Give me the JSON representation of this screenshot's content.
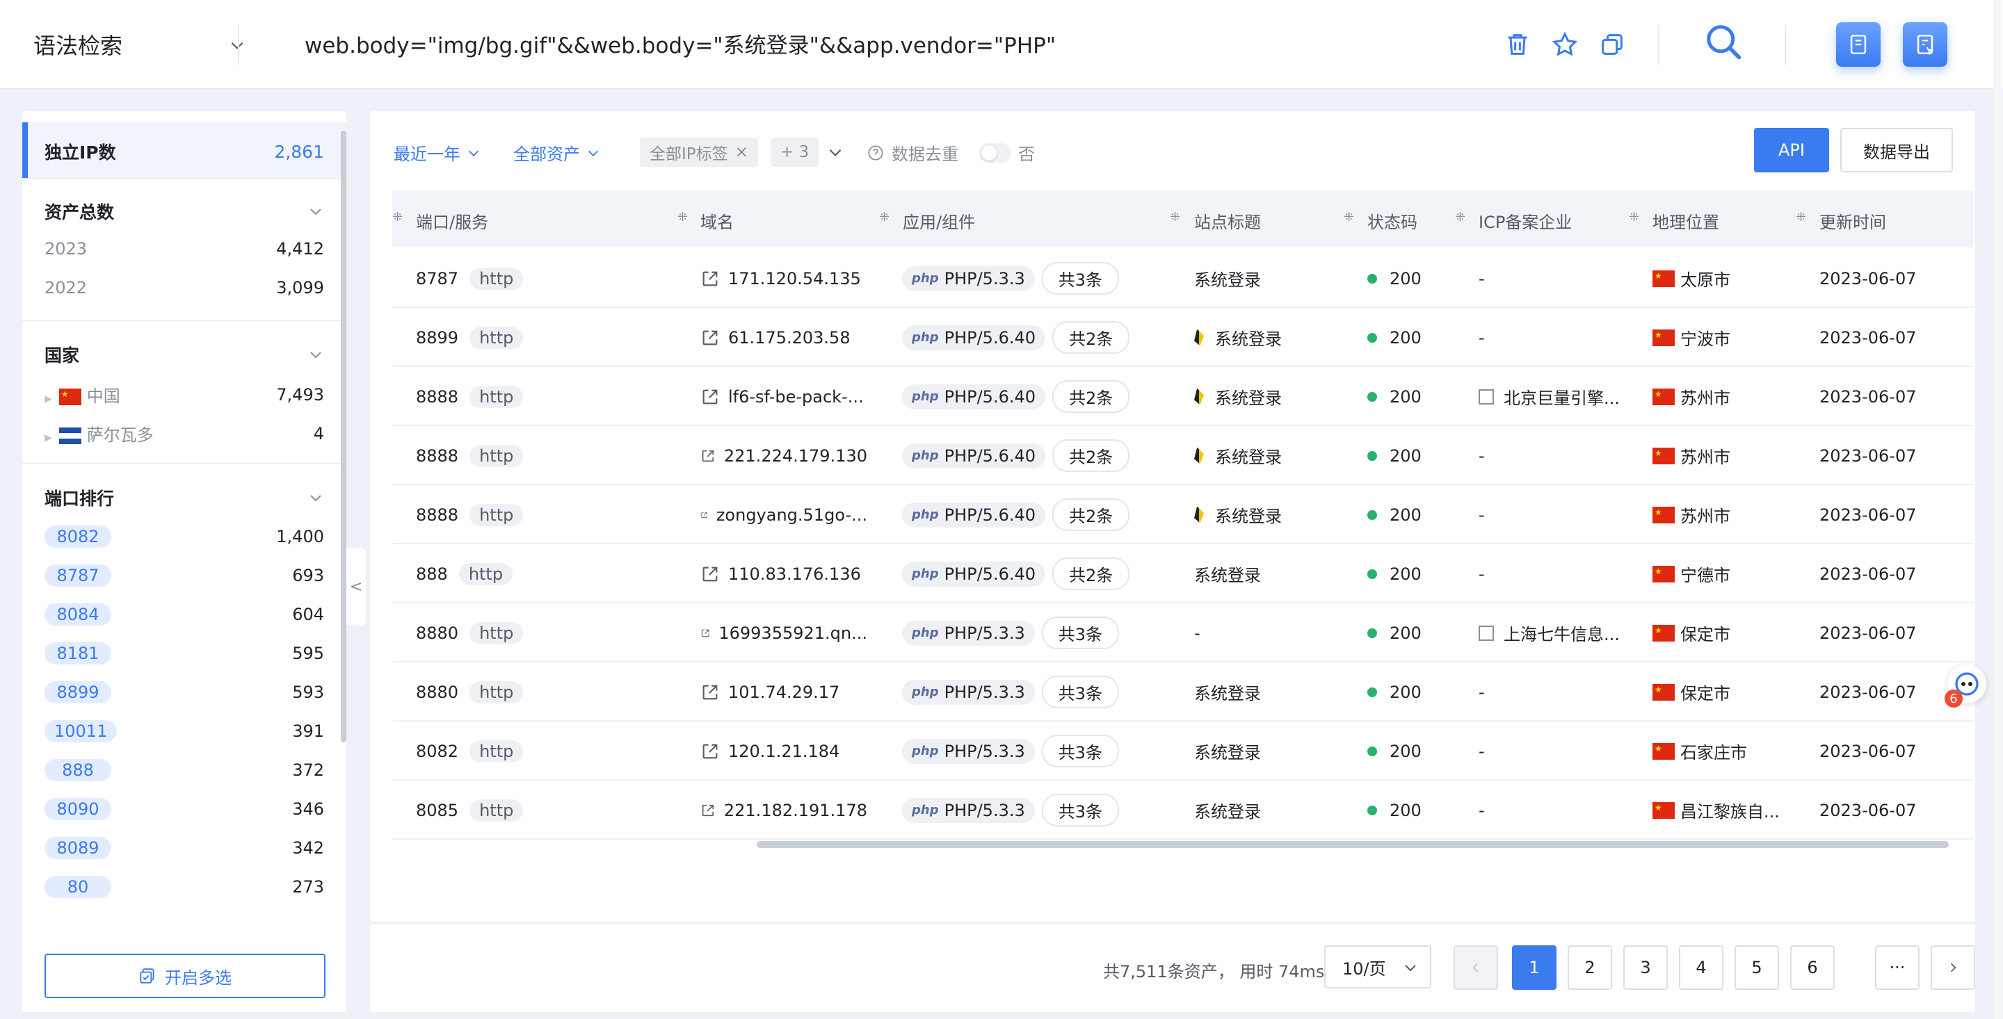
{
  "topbar": {
    "syntax_mode": "语法检索",
    "query": "web.body=\"img/bg.gif\"&&web.body=\"系统登录\"&&app.vendor=\"PHP\""
  },
  "sidebar": {
    "unique_ip": {
      "label": "独立IP数",
      "value": "2,861"
    },
    "total_assets": {
      "label": "资产总数",
      "items": [
        {
          "label": "2023",
          "value": "4,412"
        },
        {
          "label": "2022",
          "value": "3,099"
        }
      ]
    },
    "country": {
      "label": "国家",
      "items": [
        {
          "label": "中国",
          "value": "7,493"
        },
        {
          "label": "萨尔瓦多",
          "value": "4"
        }
      ]
    },
    "port_rank": {
      "label": "端口排行",
      "items": [
        {
          "port": "8082",
          "count": "1,400"
        },
        {
          "port": "8787",
          "count": "693"
        },
        {
          "port": "8084",
          "count": "604"
        },
        {
          "port": "8181",
          "count": "595"
        },
        {
          "port": "8899",
          "count": "593"
        },
        {
          "port": "10011",
          "count": "391"
        },
        {
          "port": "888",
          "count": "372"
        },
        {
          "port": "8090",
          "count": "346"
        },
        {
          "port": "8089",
          "count": "342"
        },
        {
          "port": "80",
          "count": "273"
        }
      ]
    },
    "multi_select_label": "开启多选",
    "collapse_glyph": "<"
  },
  "filters": {
    "time": "最近一年",
    "assets": "全部资产",
    "ip_tag": "全部IP标签",
    "ip_tag_close": "×",
    "more_tags": "+ 3",
    "dedupe_label": "数据去重",
    "dedupe_value": "否",
    "api_label": "API",
    "export_label": "数据导出"
  },
  "table": {
    "headers": [
      "端口/服务",
      "域名",
      "应用/组件",
      "站点标题",
      "状态码",
      "ICP备案企业",
      "地理位置",
      "更新时间"
    ],
    "rows": [
      {
        "port": "8787",
        "proto": "http",
        "host": "171.120.54.135",
        "tech": "PHP/5.3.3",
        "more": "共3条",
        "title": "系统登录",
        "favicon": false,
        "status": "200",
        "icp": "-",
        "icp_icon": false,
        "geo": "太原市",
        "date": "2023-06-07"
      },
      {
        "port": "8899",
        "proto": "http",
        "host": "61.175.203.58",
        "tech": "PHP/5.6.40",
        "more": "共2条",
        "title": "系统登录",
        "favicon": true,
        "status": "200",
        "icp": "-",
        "icp_icon": false,
        "geo": "宁波市",
        "date": "2023-06-07"
      },
      {
        "port": "8888",
        "proto": "http",
        "host": "lf6-sf-be-pack-...",
        "tech": "PHP/5.6.40",
        "more": "共2条",
        "title": "系统登录",
        "favicon": true,
        "status": "200",
        "icp": "北京巨量引擎...",
        "icp_icon": true,
        "geo": "苏州市",
        "date": "2023-06-07"
      },
      {
        "port": "8888",
        "proto": "http",
        "host": "221.224.179.130",
        "tech": "PHP/5.6.40",
        "more": "共2条",
        "title": "系统登录",
        "favicon": true,
        "status": "200",
        "icp": "-",
        "icp_icon": false,
        "geo": "苏州市",
        "date": "2023-06-07"
      },
      {
        "port": "8888",
        "proto": "http",
        "host": "zongyang.51go-...",
        "tech": "PHP/5.6.40",
        "more": "共2条",
        "title": "系统登录",
        "favicon": true,
        "status": "200",
        "icp": "-",
        "icp_icon": false,
        "geo": "苏州市",
        "date": "2023-06-07"
      },
      {
        "port": "888",
        "proto": "http",
        "host": "110.83.176.136",
        "tech": "PHP/5.6.40",
        "more": "共2条",
        "title": "系统登录",
        "favicon": false,
        "status": "200",
        "icp": "-",
        "icp_icon": false,
        "geo": "宁德市",
        "date": "2023-06-07"
      },
      {
        "port": "8880",
        "proto": "http",
        "host": "1699355921.qn...",
        "tech": "PHP/5.3.3",
        "more": "共3条",
        "title": "-",
        "favicon": false,
        "status": "200",
        "icp": "上海七牛信息...",
        "icp_icon": true,
        "geo": "保定市",
        "date": "2023-06-07"
      },
      {
        "port": "8880",
        "proto": "http",
        "host": "101.74.29.17",
        "tech": "PHP/5.3.3",
        "more": "共3条",
        "title": "系统登录",
        "favicon": false,
        "status": "200",
        "icp": "-",
        "icp_icon": false,
        "geo": "保定市",
        "date": "2023-06-07"
      },
      {
        "port": "8082",
        "proto": "http",
        "host": "120.1.21.184",
        "tech": "PHP/5.3.3",
        "more": "共3条",
        "title": "系统登录",
        "favicon": false,
        "status": "200",
        "icp": "-",
        "icp_icon": false,
        "geo": "石家庄市",
        "date": "2023-06-07"
      },
      {
        "port": "8085",
        "proto": "http",
        "host": "221.182.191.178",
        "tech": "PHP/5.3.3",
        "more": "共3条",
        "title": "系统登录",
        "favicon": false,
        "status": "200",
        "icp": "-",
        "icp_icon": false,
        "geo": "昌江黎族自...",
        "date": "2023-06-07"
      }
    ]
  },
  "pagination": {
    "summary": "共7,511条资产， 用时 74ms",
    "page_size": "10/页",
    "pages": [
      "1",
      "2",
      "3",
      "4",
      "5",
      "6"
    ],
    "ellipsis": "···",
    "active_page": "1"
  },
  "float_badge": "6",
  "colors": {
    "accent": "#3a7bf0",
    "status_ok": "#28b26b",
    "page_bg": "#eef1f7"
  }
}
